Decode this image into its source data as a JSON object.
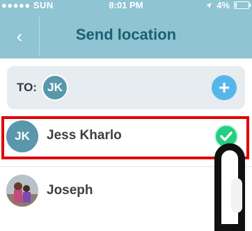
{
  "status_bar": {
    "carrier": "●●●●● SUN",
    "time": "8:01 PM",
    "battery_text": "4%"
  },
  "header": {
    "back_icon": "‹",
    "title": "Send location"
  },
  "recipients": {
    "to_label": "TO:",
    "chip_initials": "JK",
    "add_icon": "+"
  },
  "contacts": [
    {
      "initials": "JK",
      "name": "Jess Kharlo",
      "selected": true
    },
    {
      "initials": "",
      "name": "Joseph",
      "selected": false
    }
  ],
  "colors": {
    "header_bg": "#8fc4d2",
    "title": "#1d5f70",
    "accent_blue": "#56b6ea",
    "check_green": "#25cf82",
    "highlight_red": "#e00000"
  }
}
